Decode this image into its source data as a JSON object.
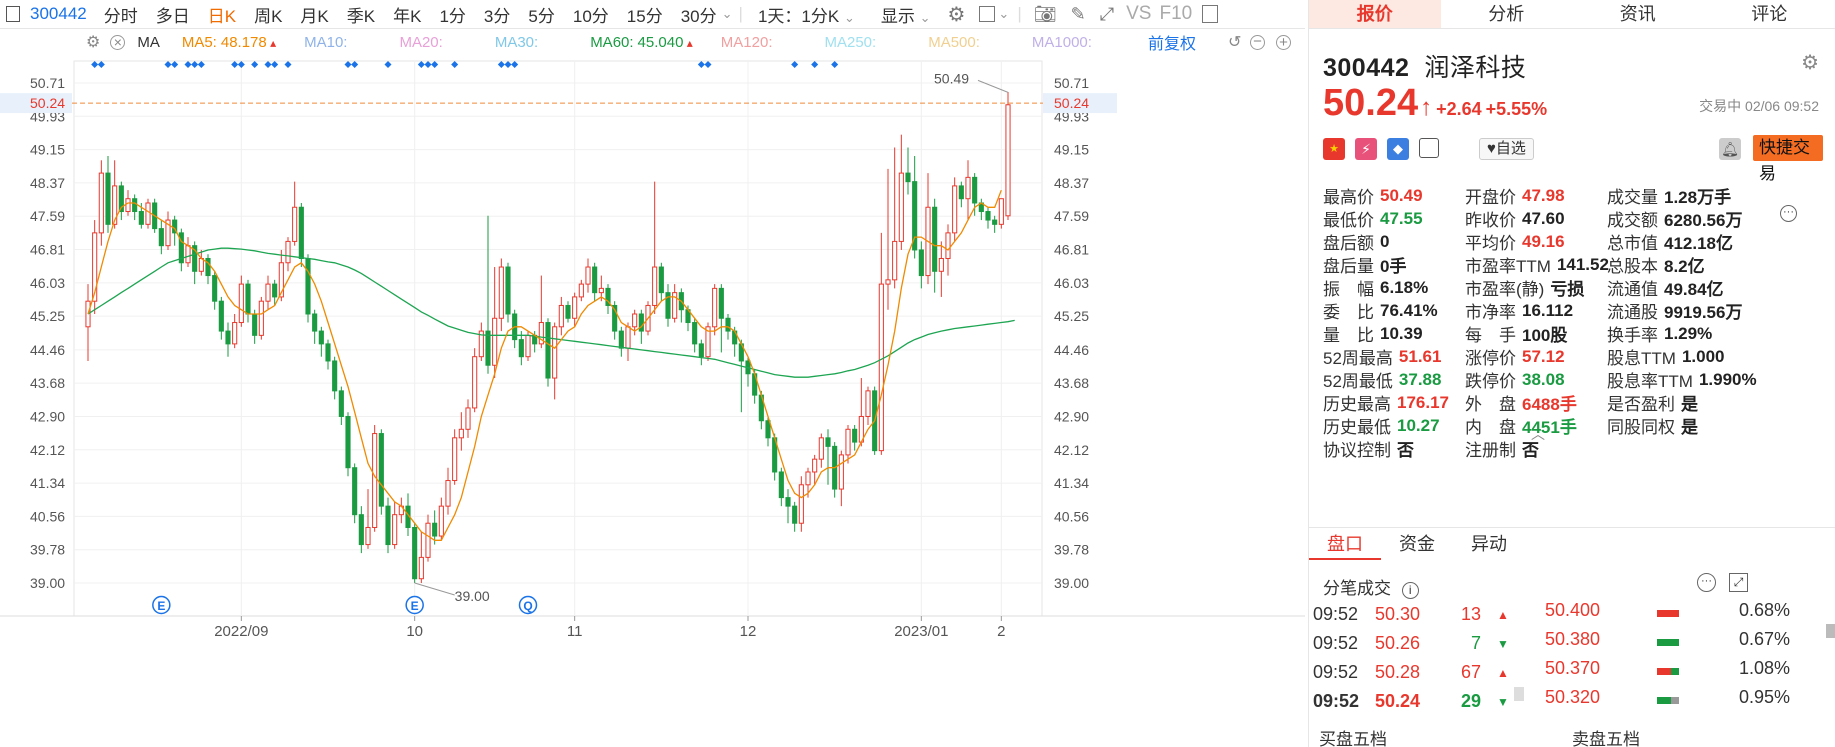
{
  "toolbar": {
    "code": "300442",
    "tabs": [
      "分时",
      "多日",
      "日K",
      "周K",
      "月K",
      "季K",
      "年K",
      "1分",
      "3分",
      "5分",
      "10分",
      "15分",
      "30分"
    ],
    "active": "日K",
    "period": "1天：1分K",
    "display": "显示",
    "vs": "VS",
    "f10": "F10"
  },
  "ma": {
    "label": "MA",
    "items": [
      {
        "name": "MA5:",
        "value": "48.178",
        "color": "#f08a00",
        "arrow": "up"
      },
      {
        "name": "MA10:",
        "value": "",
        "color": "#8fb3e8"
      },
      {
        "name": "MA20:",
        "value": "",
        "color": "#e8a0d8"
      },
      {
        "name": "MA30:",
        "value": "",
        "color": "#80c8e8"
      },
      {
        "name": "MA60:",
        "value": "45.040",
        "color": "#1a9b42",
        "arrow": "up"
      },
      {
        "name": "MA120:",
        "value": "",
        "color": "#f0a0a0"
      },
      {
        "name": "MA250:",
        "value": "",
        "color": "#a0e0f0"
      },
      {
        "name": "MA500:",
        "value": "",
        "color": "#f0d090"
      },
      {
        "name": "MA1000:",
        "value": "",
        "color": "#c0b0e8"
      }
    ],
    "adjust": "前复权"
  },
  "chart_data": {
    "type": "candlestick",
    "yticks": [
      "50.71",
      "49.93",
      "49.15",
      "48.37",
      "47.59",
      "46.81",
      "46.03",
      "45.25",
      "44.46",
      "43.68",
      "42.90",
      "42.12",
      "41.34",
      "40.56",
      "39.78",
      "39.00"
    ],
    "ylim": [
      39.0,
      50.71
    ],
    "xlabels": [
      "2022/09",
      "10",
      "11",
      "12",
      "2023/01",
      "2"
    ],
    "current_price": "50.24",
    "high_mark": "50.49",
    "low_mark": "39.00",
    "event_markers": [
      "E",
      "E",
      "Q"
    ],
    "candles": [
      [
        45.0,
        45.6,
        44.2,
        46.0
      ],
      [
        45.6,
        47.2,
        45.3,
        47.5
      ],
      [
        47.2,
        48.6,
        46.9,
        48.9
      ],
      [
        48.6,
        47.4,
        47.2,
        49.0
      ],
      [
        47.4,
        48.3,
        47.3,
        48.9
      ],
      [
        48.3,
        47.7,
        47.5,
        48.4
      ],
      [
        47.7,
        48.0,
        47.6,
        48.2
      ],
      [
        48.0,
        47.7,
        47.5,
        48.1
      ],
      [
        47.7,
        47.4,
        47.3,
        47.9
      ],
      [
        47.4,
        47.9,
        47.3,
        48.0
      ],
      [
        47.9,
        47.3,
        47.2,
        48.0
      ],
      [
        47.3,
        46.9,
        46.7,
        47.5
      ],
      [
        46.9,
        47.5,
        46.8,
        47.7
      ],
      [
        47.5,
        47.2,
        46.9,
        47.6
      ],
      [
        47.2,
        46.5,
        46.3,
        47.3
      ],
      [
        46.5,
        46.9,
        46.4,
        47.1
      ],
      [
        46.9,
        46.3,
        46.0,
        47.0
      ],
      [
        46.3,
        46.6,
        46.2,
        46.8
      ],
      [
        46.6,
        46.2,
        46.0,
        46.7
      ],
      [
        46.2,
        45.6,
        45.4,
        46.3
      ],
      [
        45.6,
        44.9,
        44.7,
        45.7
      ],
      [
        44.9,
        44.6,
        44.3,
        45.1
      ],
      [
        44.6,
        45.1,
        44.5,
        45.3
      ],
      [
        45.1,
        46.0,
        45.0,
        46.2
      ],
      [
        46.0,
        45.3,
        45.1,
        46.1
      ],
      [
        45.3,
        44.8,
        44.6,
        45.4
      ],
      [
        44.8,
        45.6,
        44.7,
        45.7
      ],
      [
        45.6,
        46.0,
        45.4,
        46.2
      ],
      [
        46.0,
        45.7,
        45.5,
        46.1
      ],
      [
        45.7,
        46.5,
        45.6,
        46.8
      ],
      [
        46.5,
        47.0,
        46.3,
        47.1
      ],
      [
        47.0,
        47.8,
        46.9,
        48.4
      ],
      [
        47.8,
        46.6,
        46.4,
        47.9
      ],
      [
        46.6,
        45.3,
        45.1,
        46.7
      ],
      [
        45.3,
        44.9,
        44.6,
        45.4
      ],
      [
        44.9,
        44.6,
        44.3,
        45.0
      ],
      [
        44.6,
        44.2,
        44.0,
        44.7
      ],
      [
        44.2,
        43.5,
        43.3,
        44.3
      ],
      [
        43.5,
        42.9,
        42.7,
        43.6
      ],
      [
        42.9,
        41.7,
        41.5,
        43.0
      ],
      [
        41.7,
        40.6,
        40.4,
        41.8
      ],
      [
        40.6,
        39.9,
        39.7,
        40.8
      ],
      [
        39.9,
        40.3,
        39.8,
        41.2
      ],
      [
        40.3,
        42.5,
        40.2,
        42.7
      ],
      [
        42.5,
        40.8,
        40.6,
        42.6
      ],
      [
        40.8,
        39.9,
        39.7,
        41.0
      ],
      [
        39.9,
        40.6,
        39.8,
        40.9
      ],
      [
        40.6,
        40.8,
        40.4,
        41.0
      ],
      [
        40.8,
        40.3,
        40.1,
        41.1
      ],
      [
        40.3,
        39.1,
        39.0,
        40.4
      ],
      [
        39.1,
        39.6,
        39.0,
        40.2
      ],
      [
        39.6,
        40.4,
        39.5,
        40.6
      ],
      [
        40.4,
        40.1,
        39.9,
        40.7
      ],
      [
        40.1,
        40.8,
        40.0,
        41.0
      ],
      [
        40.8,
        41.4,
        40.6,
        41.7
      ],
      [
        41.4,
        42.4,
        41.3,
        42.6
      ],
      [
        42.4,
        42.6,
        42.1,
        43.0
      ],
      [
        42.6,
        43.1,
        42.4,
        43.3
      ],
      [
        43.1,
        44.3,
        43.0,
        44.5
      ],
      [
        44.3,
        44.9,
        44.2,
        45.1
      ],
      [
        44.9,
        44.1,
        43.9,
        47.6
      ],
      [
        44.1,
        45.2,
        43.8,
        46.4
      ],
      [
        45.2,
        46.4,
        44.9,
        46.6
      ],
      [
        46.4,
        45.3,
        45.1,
        46.5
      ],
      [
        45.3,
        44.7,
        44.5,
        45.4
      ],
      [
        44.7,
        44.3,
        44.1,
        44.9
      ],
      [
        44.3,
        44.8,
        44.2,
        44.9
      ],
      [
        44.8,
        44.6,
        44.4,
        44.9
      ],
      [
        44.6,
        45.1,
        44.5,
        46.2
      ],
      [
        45.1,
        43.8,
        43.6,
        45.2
      ],
      [
        43.8,
        45.0,
        43.3,
        45.1
      ],
      [
        45.0,
        45.5,
        44.8,
        45.7
      ],
      [
        45.5,
        45.2,
        45.1,
        45.6
      ],
      [
        45.2,
        45.7,
        45.0,
        45.8
      ],
      [
        45.7,
        46.0,
        45.6,
        46.1
      ],
      [
        46.0,
        46.4,
        45.8,
        46.6
      ],
      [
        46.4,
        45.8,
        45.6,
        46.5
      ],
      [
        45.8,
        45.9,
        45.6,
        46.2
      ],
      [
        45.9,
        45.5,
        45.3,
        46.0
      ],
      [
        45.5,
        44.9,
        44.7,
        45.6
      ],
      [
        44.9,
        44.5,
        44.3,
        45.0
      ],
      [
        44.5,
        45.0,
        44.2,
        45.1
      ],
      [
        45.0,
        45.3,
        44.8,
        45.4
      ],
      [
        45.3,
        44.9,
        44.6,
        45.4
      ],
      [
        44.9,
        45.5,
        44.8,
        45.6
      ],
      [
        45.5,
        46.4,
        45.3,
        48.4
      ],
      [
        46.4,
        45.8,
        45.6,
        46.5
      ],
      [
        45.8,
        45.2,
        45.0,
        46.0
      ],
      [
        45.2,
        45.8,
        45.1,
        46.0
      ],
      [
        45.8,
        45.4,
        45.1,
        45.9
      ],
      [
        45.4,
        45.1,
        44.9,
        45.5
      ],
      [
        45.1,
        44.6,
        44.4,
        45.2
      ],
      [
        44.6,
        44.3,
        44.1,
        44.7
      ],
      [
        44.3,
        45.0,
        44.2,
        45.1
      ],
      [
        45.0,
        45.9,
        44.8,
        46.0
      ],
      [
        45.9,
        45.2,
        44.4,
        46.0
      ],
      [
        45.2,
        44.9,
        44.7,
        45.3
      ],
      [
        44.9,
        44.6,
        44.3,
        45.0
      ],
      [
        44.6,
        44.2,
        43.0,
        44.7
      ],
      [
        44.2,
        43.9,
        43.6,
        44.3
      ],
      [
        43.9,
        43.4,
        43.2,
        44.0
      ],
      [
        43.4,
        42.8,
        42.6,
        43.5
      ],
      [
        42.8,
        42.4,
        42.2,
        42.9
      ],
      [
        42.4,
        41.6,
        41.4,
        42.5
      ],
      [
        41.6,
        41.0,
        40.8,
        41.7
      ],
      [
        41.0,
        40.8,
        40.4,
        41.2
      ],
      [
        40.8,
        40.4,
        40.2,
        40.9
      ],
      [
        40.4,
        41.3,
        40.2,
        41.5
      ],
      [
        41.3,
        41.6,
        41.0,
        41.7
      ],
      [
        41.6,
        41.9,
        41.3,
        42.0
      ],
      [
        41.9,
        42.4,
        41.7,
        42.5
      ],
      [
        42.4,
        42.2,
        41.3,
        42.6
      ],
      [
        42.2,
        41.2,
        41.0,
        42.3
      ],
      [
        41.2,
        42.0,
        40.8,
        42.1
      ],
      [
        42.0,
        42.6,
        41.8,
        42.7
      ],
      [
        42.6,
        42.3,
        42.1,
        42.7
      ],
      [
        42.3,
        42.9,
        42.2,
        43.8
      ],
      [
        42.9,
        43.5,
        42.7,
        43.6
      ],
      [
        43.5,
        42.1,
        42.0,
        43.6
      ],
      [
        42.1,
        46.0,
        42.0,
        47.2
      ],
      [
        46.0,
        46.1,
        45.4,
        48.7
      ],
      [
        46.1,
        47.0,
        45.9,
        49.2
      ],
      [
        47.0,
        48.6,
        46.8,
        49.5
      ],
      [
        48.6,
        48.4,
        48.1,
        49.2
      ],
      [
        48.4,
        46.8,
        46.6,
        49.0
      ],
      [
        46.8,
        46.2,
        45.9,
        47.0
      ],
      [
        46.2,
        47.8,
        46.0,
        48.6
      ],
      [
        47.8,
        46.3,
        45.8,
        48.0
      ],
      [
        46.3,
        46.6,
        45.7,
        47.0
      ],
      [
        46.6,
        47.2,
        46.2,
        47.4
      ],
      [
        47.2,
        48.3,
        47.0,
        48.5
      ],
      [
        48.3,
        48.0,
        47.8,
        48.4
      ],
      [
        48.0,
        48.5,
        47.5,
        48.9
      ],
      [
        48.5,
        47.9,
        47.6,
        48.6
      ],
      [
        47.9,
        47.7,
        47.5,
        48.0
      ],
      [
        47.7,
        47.5,
        47.3,
        47.8
      ],
      [
        47.5,
        47.4,
        47.2,
        47.6
      ],
      [
        47.4,
        48.0,
        47.3,
        48.0
      ],
      [
        47.6,
        50.2,
        47.5,
        50.5
      ]
    ],
    "ma5": [
      45.3,
      45.8,
      46.4,
      47.0,
      47.5,
      47.8,
      47.9,
      47.9,
      47.8,
      47.7,
      47.6,
      47.5,
      47.4,
      47.3,
      47.0,
      46.9,
      46.8,
      46.6,
      46.5,
      46.3,
      46.0,
      45.7,
      45.5,
      45.4,
      45.3,
      45.3,
      45.3,
      45.4,
      45.5,
      45.8,
      46.1,
      46.4,
      46.5,
      46.3,
      46.0,
      45.6,
      45.1,
      44.6,
      44.1,
      43.6,
      43.0,
      42.4,
      41.8,
      41.5,
      41.3,
      41.1,
      40.9,
      40.8,
      40.6,
      40.4,
      40.2,
      40.1,
      40.0,
      40.0,
      40.3,
      40.6,
      41.0,
      41.6,
      42.2,
      42.9,
      43.4,
      43.9,
      44.5,
      44.9,
      45.0,
      45.0,
      44.9,
      44.8,
      44.7,
      44.6,
      44.5,
      44.7,
      44.9,
      45.0,
      45.3,
      45.5,
      45.6,
      45.7,
      45.6,
      45.4,
      45.1,
      45.0,
      44.9,
      45.0,
      45.2,
      45.4,
      45.6,
      45.7,
      45.7,
      45.6,
      45.4,
      45.2,
      45.0,
      44.9,
      44.9,
      45.0,
      45.0,
      44.9,
      44.6,
      44.3,
      43.9,
      43.4,
      42.9,
      42.4,
      41.9,
      41.4,
      41.1,
      41.0,
      41.1,
      41.3,
      41.6,
      41.7,
      41.7,
      41.8,
      41.9,
      42.0,
      42.3,
      42.6,
      42.8,
      43.4,
      44.1,
      44.9,
      45.9,
      46.7,
      47.1,
      47.1,
      47.0,
      46.9,
      46.9,
      46.8,
      47.0,
      47.2,
      47.5,
      47.8,
      47.9,
      47.8,
      47.8,
      48.2
    ],
    "ma60": [
      45.3,
      45.4,
      45.5,
      45.6,
      45.7,
      45.8,
      45.9,
      46.0,
      46.1,
      46.2,
      46.3,
      46.4,
      46.5,
      46.55,
      46.6,
      46.65,
      46.7,
      46.75,
      46.8,
      46.82,
      46.84,
      46.84,
      46.83,
      46.82,
      46.8,
      46.78,
      46.75,
      46.72,
      46.7,
      46.68,
      46.66,
      46.64,
      46.62,
      46.6,
      46.58,
      46.55,
      46.52,
      46.5,
      46.45,
      46.4,
      46.33,
      46.25,
      46.15,
      46.05,
      45.95,
      45.85,
      45.75,
      45.65,
      45.55,
      45.45,
      45.35,
      45.27,
      45.18,
      45.1,
      45.02,
      44.97,
      44.92,
      44.87,
      44.84,
      44.81,
      44.8,
      44.8,
      44.8,
      44.8,
      44.8,
      44.8,
      44.8,
      44.78,
      44.76,
      44.74,
      44.72,
      44.7,
      44.68,
      44.66,
      44.64,
      44.62,
      44.6,
      44.58,
      44.56,
      44.54,
      44.52,
      44.5,
      44.48,
      44.46,
      44.44,
      44.42,
      44.4,
      44.38,
      44.36,
      44.34,
      44.32,
      44.3,
      44.28,
      44.26,
      44.24,
      44.2,
      44.16,
      44.12,
      44.08,
      44.04,
      44.0,
      43.96,
      43.92,
      43.88,
      43.86,
      43.84,
      43.82,
      43.82,
      43.82,
      43.84,
      43.86,
      43.88,
      43.9,
      43.93,
      43.97,
      44.0,
      44.05,
      44.1,
      44.16,
      44.24,
      44.32,
      44.42,
      44.52,
      44.62,
      44.7,
      44.76,
      44.82,
      44.86,
      44.9,
      44.93,
      44.96,
      44.98,
      45.0,
      45.02,
      45.04,
      45.06,
      45.08,
      45.1,
      45.12,
      45.15
    ]
  },
  "right": {
    "tabs": [
      "报价",
      "分析",
      "资讯",
      "评论"
    ],
    "active_tab": "报价",
    "code": "300442",
    "name": "润泽科技",
    "price": "50.24",
    "change": "+2.64",
    "pct": "+5.55%",
    "status": "交易中 02/06 09:52",
    "fav": "自选",
    "quick": "快捷交易",
    "stats": [
      [
        {
          "l": "最高价",
          "v": "50.49",
          "c": "red"
        },
        {
          "l": "开盘价",
          "v": "47.98",
          "c": "red"
        },
        {
          "l": "成交量",
          "v": "1.28万手",
          "c": "blk"
        }
      ],
      [
        {
          "l": "最低价",
          "v": "47.55",
          "c": "green"
        },
        {
          "l": "昨收价",
          "v": "47.60",
          "c": "blk"
        },
        {
          "l": "成交额",
          "v": "6280.56万",
          "c": "blk"
        }
      ],
      [
        {
          "l": "盘后额",
          "v": "0",
          "c": "blk"
        },
        {
          "l": "平均价",
          "v": "49.16",
          "c": "red"
        },
        {
          "l": "总市值",
          "v": "412.18亿",
          "c": "blk"
        }
      ],
      [
        {
          "l": "盘后量",
          "v": "0手",
          "c": "blk"
        },
        {
          "l": "市盈率TTM",
          "v": "141.52",
          "c": "blk"
        },
        {
          "l": "总股本",
          "v": "8.2亿",
          "c": "blk"
        }
      ],
      [
        {
          "l": "振　幅",
          "v": "6.18%",
          "c": "blk"
        },
        {
          "l": "市盈率(静)",
          "v": "亏损",
          "c": "blk"
        },
        {
          "l": "流通值",
          "v": "49.84亿",
          "c": "blk"
        }
      ],
      [
        {
          "l": "委　比",
          "v": "76.41%",
          "c": "blk"
        },
        {
          "l": "市净率",
          "v": "16.112",
          "c": "blk"
        },
        {
          "l": "流通股",
          "v": "9919.56万",
          "c": "blk"
        }
      ],
      [
        {
          "l": "量　比",
          "v": "10.39",
          "c": "blk"
        },
        {
          "l": "每　手",
          "v": "100股",
          "c": "blk"
        },
        {
          "l": "换手率",
          "v": "1.29%",
          "c": "blk"
        }
      ],
      [
        {
          "l": "52周最高",
          "v": "51.61",
          "c": "red"
        },
        {
          "l": "涨停价",
          "v": "57.12",
          "c": "red"
        },
        {
          "l": "股息TTM",
          "v": "1.000",
          "c": "blk"
        }
      ],
      [
        {
          "l": "52周最低",
          "v": "37.88",
          "c": "green"
        },
        {
          "l": "跌停价",
          "v": "38.08",
          "c": "green"
        },
        {
          "l": "股息率TTM",
          "v": "1.990%",
          "c": "blk"
        }
      ],
      [
        {
          "l": "历史最高",
          "v": "176.17",
          "c": "red"
        },
        {
          "l": "外　盘",
          "v": "6488手",
          "c": "red"
        },
        {
          "l": "是否盈利",
          "v": "是",
          "c": "blk"
        }
      ],
      [
        {
          "l": "历史最低",
          "v": "10.27",
          "c": "green"
        },
        {
          "l": "内　盘",
          "v": "4451手",
          "c": "green"
        },
        {
          "l": "同股同权",
          "v": "是",
          "c": "blk"
        }
      ],
      [
        {
          "l": "协议控制",
          "v": "否",
          "c": "blk"
        },
        {
          "l": "注册制",
          "v": "否",
          "c": "blk"
        }
      ]
    ],
    "subtabs": [
      "盘口",
      "资金",
      "异动"
    ],
    "tick_title": "分笔成交",
    "ticks": [
      {
        "t": "09:52",
        "p": "50.30",
        "v": "13",
        "d": "up"
      },
      {
        "t": "09:52",
        "p": "50.26",
        "v": "7",
        "d": "down"
      },
      {
        "t": "09:52",
        "p": "50.28",
        "v": "67",
        "d": "up"
      },
      {
        "t": "09:52",
        "p": "50.24",
        "v": "29",
        "d": "down"
      }
    ],
    "book": [
      {
        "p": "50.400",
        "pct": "0.68%"
      },
      {
        "p": "50.380",
        "pct": "0.67%"
      },
      {
        "p": "50.370",
        "pct": "1.08%"
      },
      {
        "p": "50.320",
        "pct": "0.95%"
      }
    ],
    "bottom": [
      "买盘五档",
      "卖盘五档"
    ]
  }
}
